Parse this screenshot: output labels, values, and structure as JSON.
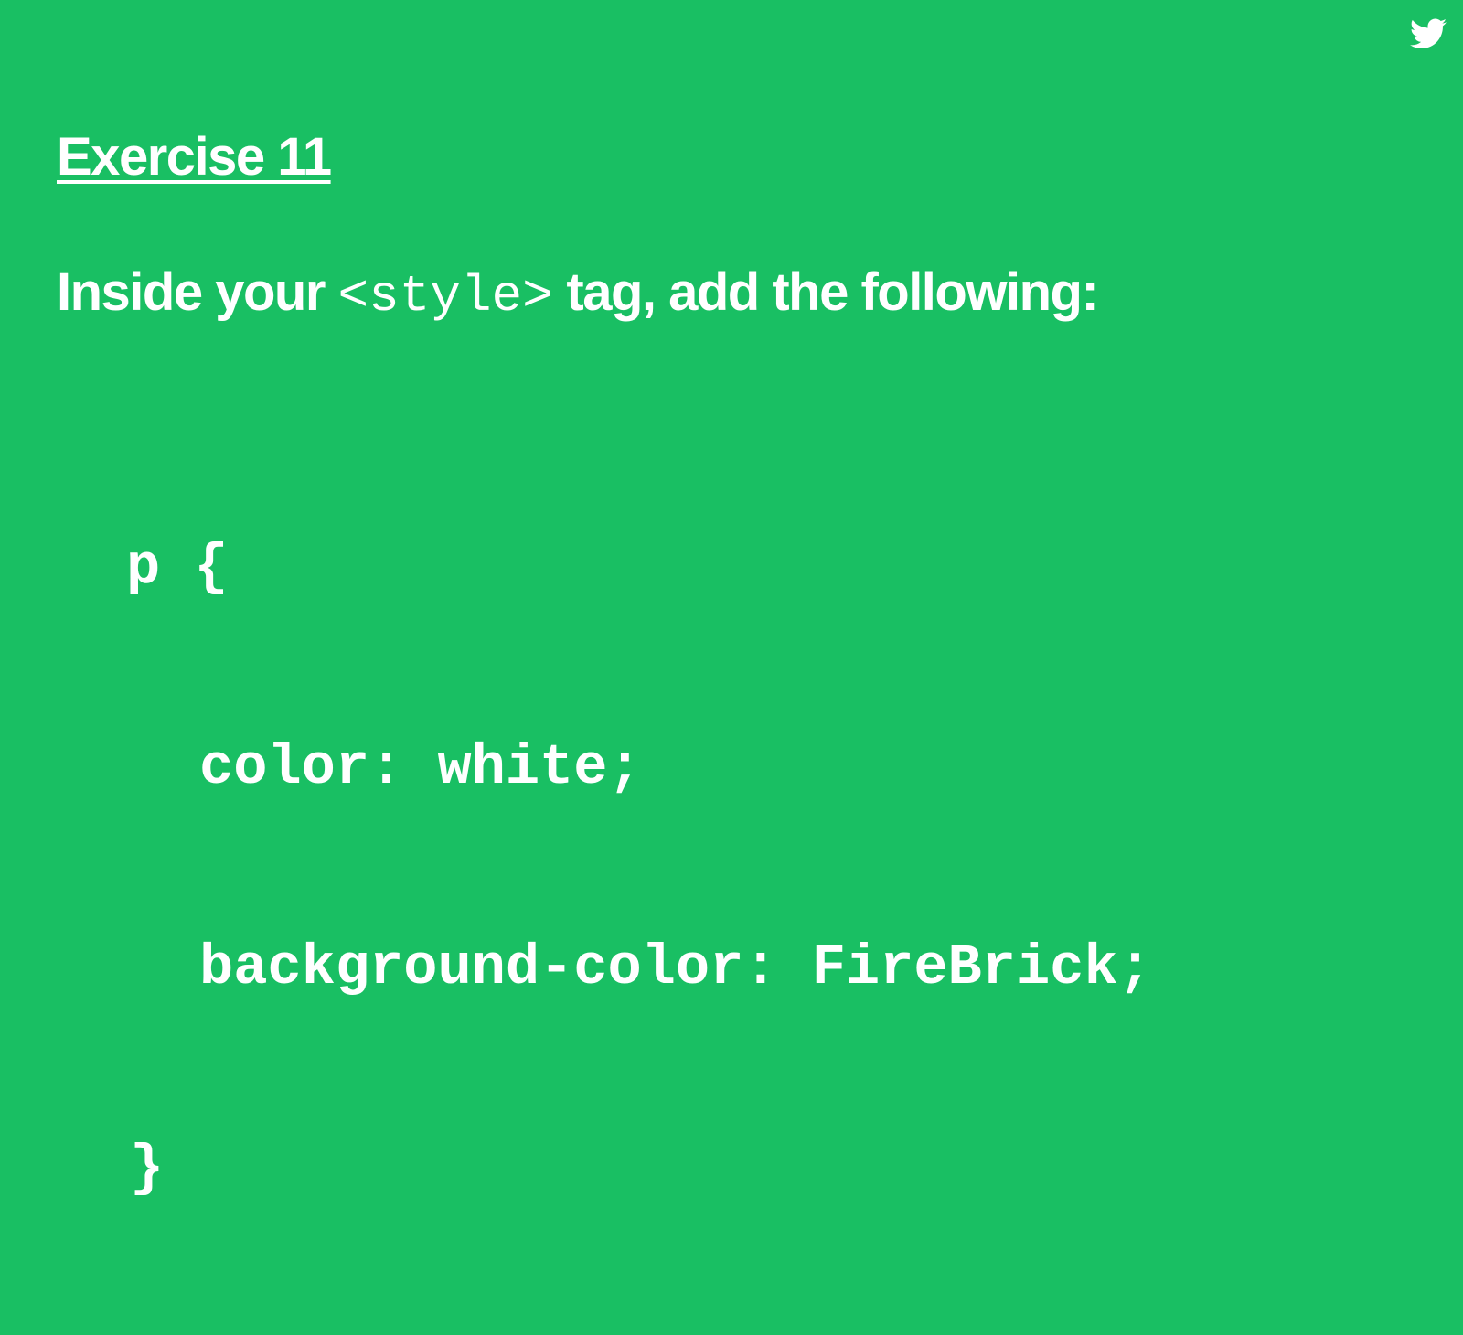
{
  "slide": {
    "background_color": "#19bf63",
    "text_color": "#ffffff",
    "corner_icon": "twitter-bird-icon",
    "title": "Exercise 11",
    "instruction": {
      "before": "Inside your ",
      "code": "<style>",
      "after": " tag, add the following:"
    },
    "code_lines": [
      "p {",
      "color: white;",
      "background-color: FireBrick;",
      "}"
    ]
  }
}
